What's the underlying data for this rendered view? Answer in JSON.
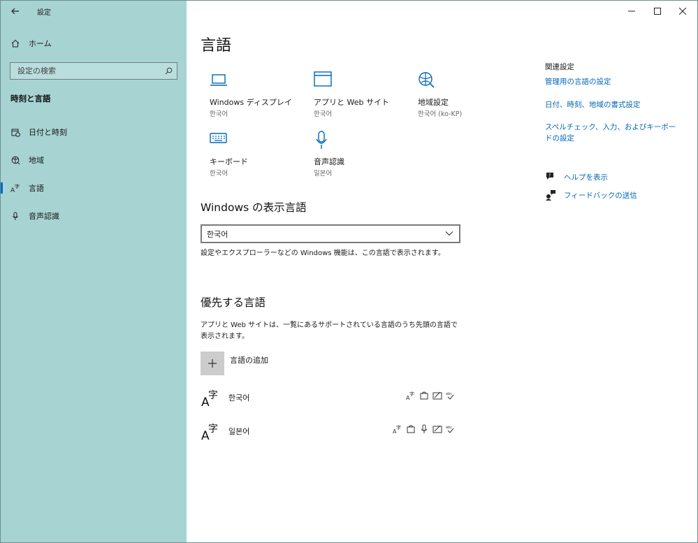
{
  "window": {
    "app_title": "設定",
    "controls": {
      "minimize": "—",
      "maximize": "☐",
      "close": "✕"
    }
  },
  "sidebar": {
    "home_label": "ホーム",
    "search_placeholder": "設定の検索",
    "section_title": "時刻と言語",
    "items": [
      {
        "label": "日付と時刻",
        "icon": "calendar-clock-icon"
      },
      {
        "label": "地域",
        "icon": "globe-region-icon"
      },
      {
        "label": "言語",
        "icon": "language-icon",
        "selected": true
      },
      {
        "label": "音声認識",
        "icon": "microphone-icon"
      }
    ]
  },
  "main": {
    "title": "言語",
    "tiles": [
      {
        "label": "Windows ディスプレイ",
        "sub": "한국어",
        "icon": "laptop-icon"
      },
      {
        "label": "アプリと Web サイト",
        "sub": "한국어",
        "icon": "browser-window-icon"
      },
      {
        "label": "地域設定",
        "sub": "한국어 (ko-KP)",
        "icon": "globe-settings-icon"
      },
      {
        "label": "キーボード",
        "sub": "한국어",
        "icon": "keyboard-icon"
      },
      {
        "label": "音声認識",
        "sub": "일본어",
        "icon": "microphone-icon"
      }
    ],
    "display_language": {
      "heading": "Windows の表示言語",
      "selected": "한국어",
      "description": "設定やエクスプローラーなどの Windows 機能は、この言語で表示されます。"
    },
    "preferred": {
      "heading": "優先する言語",
      "description": "アプリと Web サイトは、一覧にあるサポートされている言語のうち先頭の言語で表示されます。",
      "add_label": "言語の追加",
      "languages": [
        {
          "name": "한국어",
          "features": [
            "display-language-icon",
            "text-to-speech-icon",
            "handwriting-icon",
            "spellcheck-icon"
          ]
        },
        {
          "name": "일본어",
          "features": [
            "display-language-icon",
            "text-to-speech-icon",
            "speech-recognition-icon",
            "handwriting-icon",
            "spellcheck-icon"
          ]
        }
      ]
    }
  },
  "related": {
    "title": "関連設定",
    "links": [
      "管理用の言語の設定",
      "日付、時刻、地域の書式設定",
      "スペルチェック、入力、およびキーボードの設定"
    ],
    "help": "ヘルプを表示",
    "feedback": "フィードバックの送信"
  },
  "colors": {
    "sidebar_bg": "#a7d3d2",
    "accent": "#0067b8",
    "selected_indicator": "#0067c0"
  }
}
